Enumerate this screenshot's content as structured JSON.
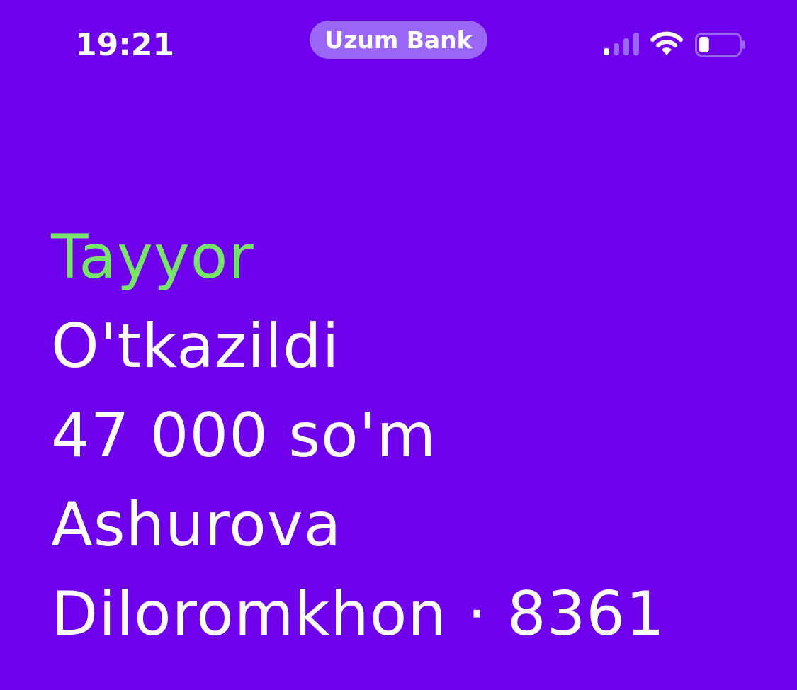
{
  "status_bar": {
    "time": "19:21",
    "app_name": "Uzum Bank",
    "signal_icon": "cellular-signal-icon",
    "wifi_icon": "wifi-icon",
    "battery_icon": "battery-icon",
    "signal_strength_bars": 1,
    "battery_level": 0.25
  },
  "notification": {
    "status": "Tayyor",
    "title": "O'tkazildi",
    "amount": "47 000 so'm",
    "recipient_last_name": "Ashurova",
    "recipient_first_name_and_card": "Diloromkhon · 8361"
  },
  "colors": {
    "background": "#6E00EB",
    "status_text": "#79E46A",
    "pill": "#9A66F5",
    "text": "#FFFFFF"
  }
}
